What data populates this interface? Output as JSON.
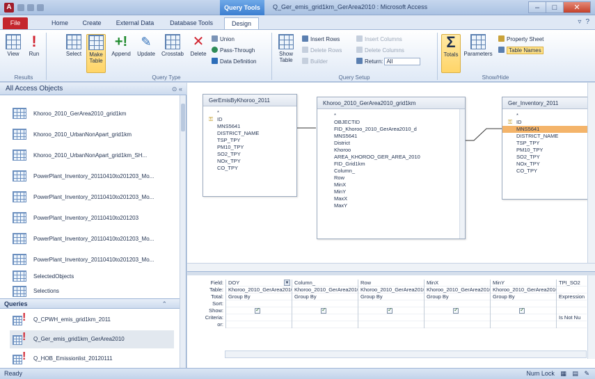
{
  "titlebar": {
    "app_icon": "A",
    "contextual_tab": "Query Tools",
    "title": "Q_Ger_emis_grid1km_GerArea2010 : Microsoft Access",
    "min": "–",
    "max": "□",
    "close": "✕"
  },
  "tabs": {
    "file": "File",
    "home": "Home",
    "create": "Create",
    "external": "External Data",
    "dbtools": "Database Tools",
    "design": "Design"
  },
  "ribbon": {
    "view": "View",
    "run": "Run",
    "select": "Select",
    "make_table": "Make Table",
    "append": "Append",
    "update": "Update",
    "crosstab": "Crosstab",
    "delete": "Delete",
    "union": "Union",
    "passthrough": "Pass-Through",
    "data_definition": "Data Definition",
    "show_table": "Show Table",
    "insert_rows": "Insert Rows",
    "delete_rows": "Delete Rows",
    "builder": "Builder",
    "insert_columns": "Insert Columns",
    "delete_columns": "Delete Columns",
    "return_label": "Return:",
    "return_value": "All",
    "totals": "Totals",
    "parameters": "Parameters",
    "property_sheet": "Property Sheet",
    "table_names": "Table Names",
    "groups": {
      "results": "Results",
      "query_type": "Query Type",
      "query_setup": "Query Setup",
      "show_hide": "Show/Hide"
    }
  },
  "nav": {
    "header": "All Access Objects",
    "items": [
      "Khoroo_2010_GerArea2010_grid1km",
      "Khoroo_2010_UrbanNonApart_grid1km",
      "Khoroo_2010_UrbanNonApart_grid1km_SH...",
      "PowerPlant_Inventory_20110410to201203_Mo...",
      "PowerPlant_Inventory_20110410to201203_Mo...",
      "PowerPlant_Inventory_20110410to201203",
      "PowerPlant_Inventory_20110410to201203_Mo...",
      "PowerPlant_Inventory_20110410to201203_Mo...",
      "SelectedObjects",
      "Selections"
    ],
    "queries_header": "Queries",
    "queries": [
      "Q_CPWH_emis_grid1km_2011",
      "Q_Ger_emis_grid1km_GerArea2010",
      "Q_HOB_Emissionlist_20120111"
    ]
  },
  "tables": {
    "t1": {
      "title": "GerEmisByKhoroo_2011",
      "fields": [
        "*",
        "ID",
        "MNS5641",
        "DISTRICT_NAME",
        "TSP_TPY",
        "PM10_TPY",
        "SO2_TPY",
        "NOx_TPY",
        "CO_TPY"
      ]
    },
    "t2": {
      "title": "Khoroo_2010_GerArea2010_grid1km",
      "fields": [
        "*",
        "OBJECTID",
        "FID_Khoroo_2010_GerArea2010_d",
        "MNS5641",
        "District",
        "Khoroo",
        "AREA_KHOROO_GER_AREA_2010",
        "FID_Grid1km",
        "Column_",
        "Row",
        "MinX",
        "MinY",
        "MaxX",
        "MaxY"
      ]
    },
    "t3": {
      "title": "Ger_Inventory_2011",
      "fields": [
        "*",
        "ID",
        "MNS5641",
        "DISTRICT_NAME",
        "TSP_TPY",
        "PM10_TPY",
        "SO2_TPY",
        "NOx_TPY",
        "CO_TPY"
      ]
    }
  },
  "qbe": {
    "row_labels": [
      "Field:",
      "Table:",
      "Total:",
      "Sort:",
      "Show:",
      "Criteria:",
      "or:"
    ],
    "columns": [
      {
        "field": "DOY",
        "table": "Khoroo_2010_GerArea2010",
        "total": "Group By",
        "criteria": ""
      },
      {
        "field": "Column_",
        "table": "Khoroo_2010_GerArea2010",
        "total": "Group By",
        "criteria": ""
      },
      {
        "field": "Row",
        "table": "Khoroo_2010_GerArea2010",
        "total": "Group By",
        "criteria": ""
      },
      {
        "field": "MinX",
        "table": "Khoroo_2010_GerArea2010",
        "total": "Group By",
        "criteria": ""
      },
      {
        "field": "MinY",
        "table": "Khoroo_2010_GerArea2010",
        "total": "Group By",
        "criteria": ""
      },
      {
        "field": "TPI_SO2",
        "table": "",
        "total": "Expression",
        "criteria": "Is Not Nu"
      }
    ]
  },
  "status": {
    "left": "Ready",
    "numlock": "Num Lock"
  }
}
